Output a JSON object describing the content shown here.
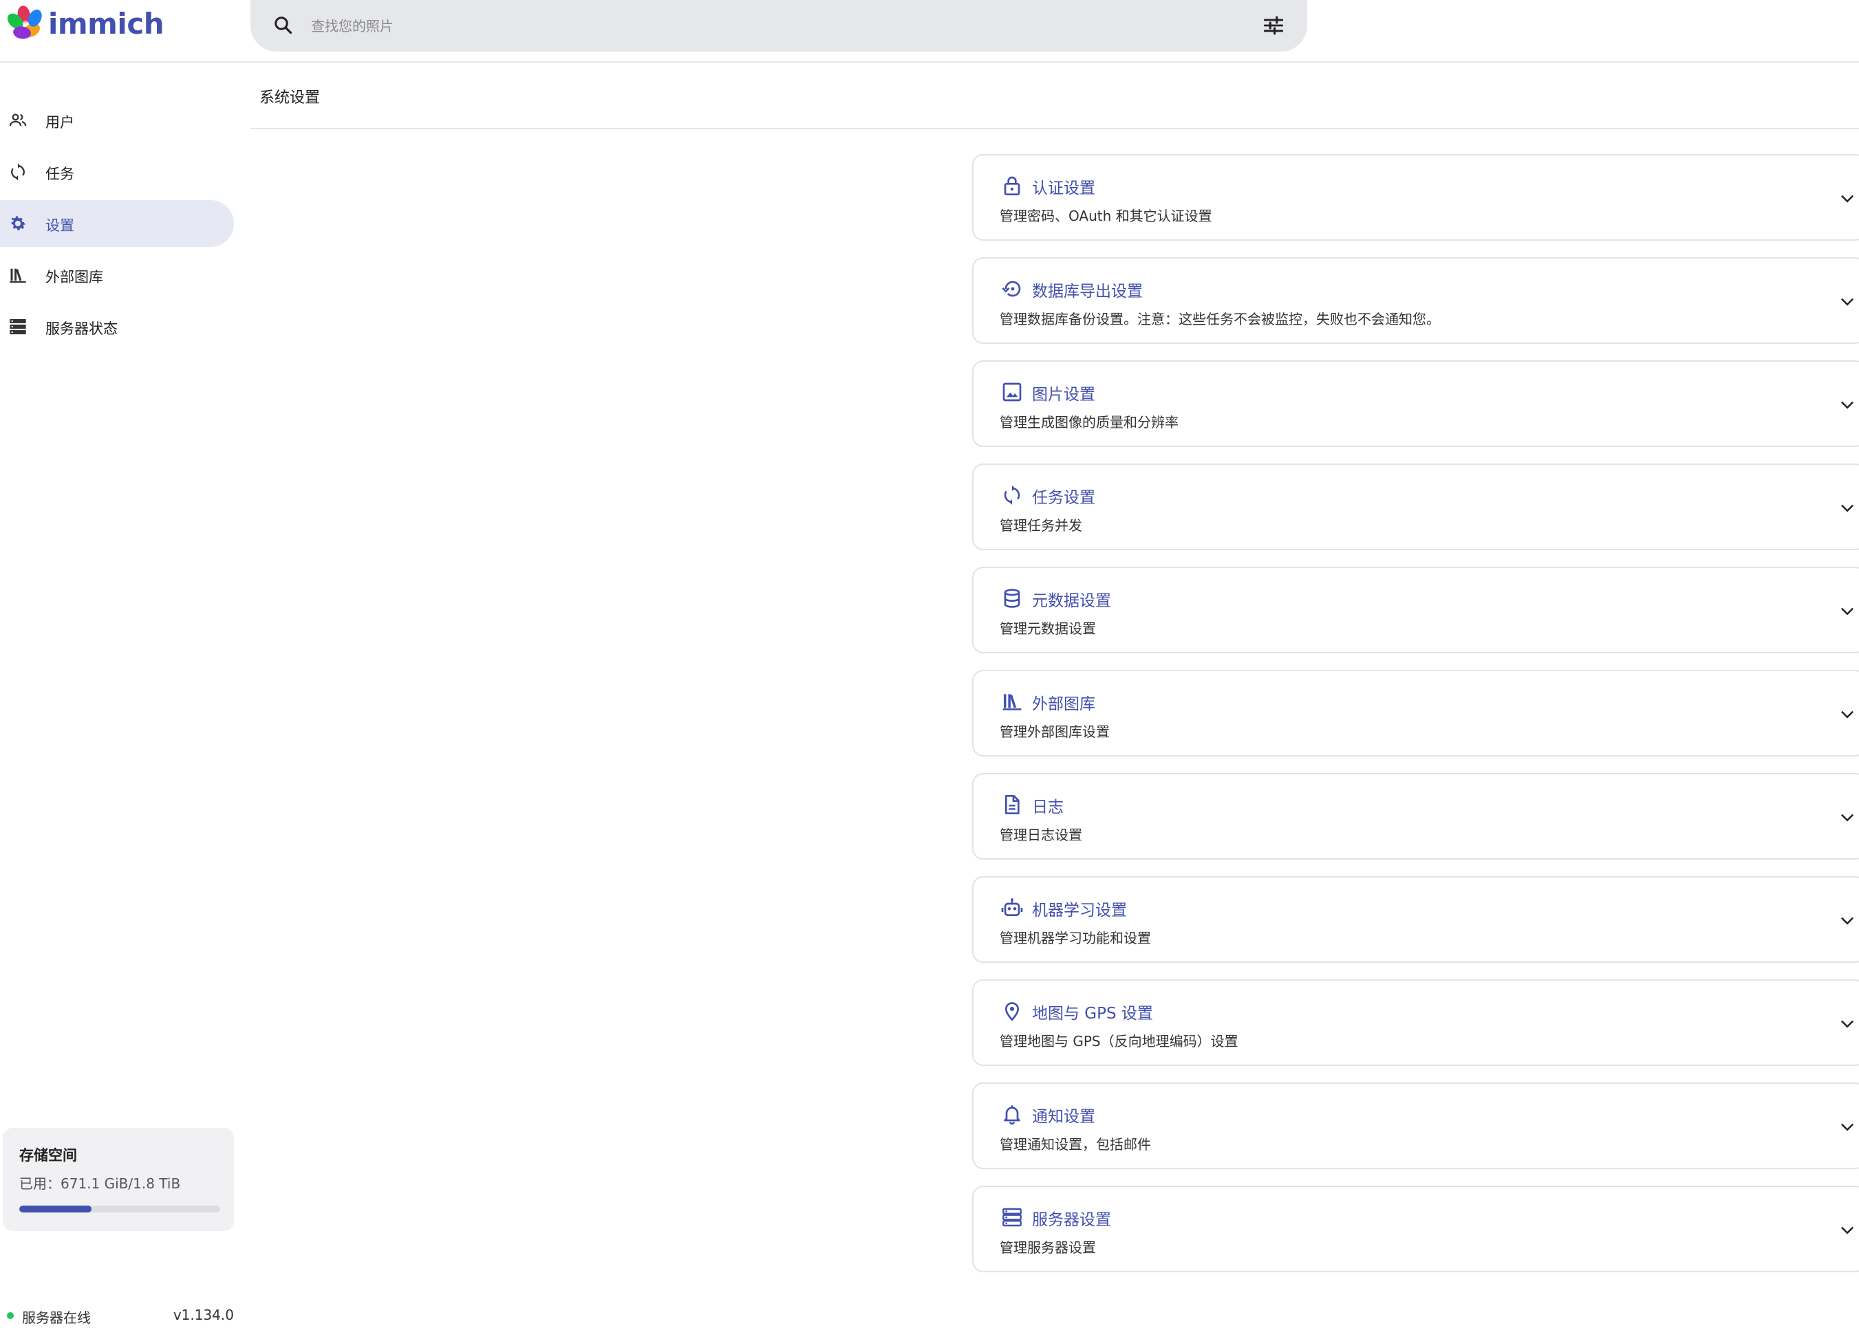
{
  "app": {
    "name": "immich"
  },
  "search": {
    "placeholder": "查找您的照片",
    "value": ""
  },
  "sidebar": {
    "items": [
      {
        "label": "用户",
        "icon": "users-icon",
        "active": false
      },
      {
        "label": "任务",
        "icon": "sync-icon",
        "active": false
      },
      {
        "label": "设置",
        "icon": "gear-icon",
        "active": true
      },
      {
        "label": "外部图库",
        "icon": "library-icon",
        "active": false
      },
      {
        "label": "服务器状态",
        "icon": "server-icon",
        "active": false
      }
    ],
    "storage": {
      "title": "存储空间",
      "used": "已用：671.1 GiB/1.8 TiB",
      "fraction": 0.36
    },
    "server": {
      "status": "服务器在线",
      "version": "v1.134.0"
    }
  },
  "page": {
    "title": "系统设置"
  },
  "settings": [
    {
      "title": "认证设置",
      "description": "管理密码、OAuth 和其它认证设置",
      "icon": "lock-icon"
    },
    {
      "title": "数据库导出设置",
      "description": "管理数据库备份设置。注意：这些任务不会被监控，失败也不会通知您。",
      "icon": "backup-restore-icon"
    },
    {
      "title": "图片设置",
      "description": "管理生成图像的质量和分辨率",
      "icon": "image-icon"
    },
    {
      "title": "任务设置",
      "description": "管理任务并发",
      "icon": "sync-icon"
    },
    {
      "title": "元数据设置",
      "description": "管理元数据设置",
      "icon": "database-icon"
    },
    {
      "title": "外部图库",
      "description": "管理外部图库设置",
      "icon": "library-icon"
    },
    {
      "title": "日志",
      "description": "管理日志设置",
      "icon": "file-document-icon"
    },
    {
      "title": "机器学习设置",
      "description": "管理机器学习功能和设置",
      "icon": "robot-icon"
    },
    {
      "title": "地图与 GPS 设置",
      "description": "管理地图与 GPS（反向地理编码）设置",
      "icon": "map-marker-icon"
    },
    {
      "title": "通知设置",
      "description": "管理通知设置，包括邮件",
      "icon": "bell-icon"
    },
    {
      "title": "服务器设置",
      "description": "管理服务器设置",
      "icon": "server-icon"
    }
  ],
  "colors": {
    "accent": "#4250af",
    "active_bg": "#e6e8f4",
    "status_online": "#22c55e",
    "search_bg": "#e6e7ea"
  }
}
